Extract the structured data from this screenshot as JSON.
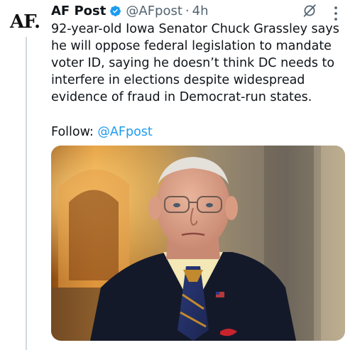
{
  "tweet": {
    "avatar_text": "AF.",
    "author_name": "AF Post",
    "handle": "@AFpost",
    "separator": "·",
    "time": "4h",
    "text": "92-year-old Iowa Senator Chuck Grassley says he will oppose federal legislation to mandate voter ID, saying he doesn’t think DC needs to interfere in elections despite widespread evidence of fraud in Democrat-run states.",
    "follow_label": "Follow:",
    "follow_handle": "@AFpost"
  },
  "icons": {
    "verified": "verified-badge-icon",
    "grok": "grok-icon",
    "more": "more-options-icon"
  },
  "colors": {
    "text": "#0f1419",
    "secondary": "#536471",
    "link": "#1d9bf0",
    "thread_line": "#cfd9de"
  }
}
